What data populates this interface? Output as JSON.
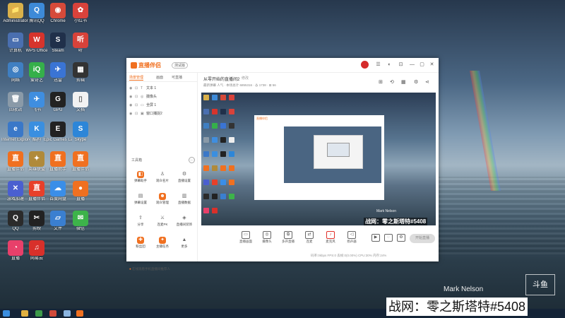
{
  "desktop": {
    "icons": [
      {
        "label": "Administrator",
        "color": "#d9b04a",
        "glyph": "📁"
      },
      {
        "label": "腾讯QQ",
        "color": "#3d8ad8",
        "glyph": "Q"
      },
      {
        "label": "Chrome",
        "color": "#d64a3a",
        "glyph": "◉"
      },
      {
        "label": "小红书",
        "color": "#d9423b",
        "glyph": "✿"
      },
      {
        "label": "计算机",
        "color": "#4a6fb0",
        "glyph": "▭"
      },
      {
        "label": "WPS Office",
        "color": "#d6342c",
        "glyph": "W"
      },
      {
        "label": "Steam",
        "color": "#20304a",
        "glyph": "S"
      },
      {
        "label": "听",
        "color": "#d8423a",
        "glyph": "听"
      },
      {
        "label": "网络",
        "color": "#3f7fc2",
        "glyph": "◎"
      },
      {
        "label": "爱奇艺",
        "color": "#35b04a",
        "glyph": "iQ"
      },
      {
        "label": "迅雷",
        "color": "#3a74d4",
        "glyph": "✈"
      },
      {
        "label": "剪辑",
        "color": "#333333",
        "glyph": "▦"
      },
      {
        "label": "回收站",
        "color": "#8a9aa8",
        "glyph": "🗑"
      },
      {
        "label": "飞书",
        "color": "#3f8ee0",
        "glyph": "✈"
      },
      {
        "label": "GPU",
        "color": "#222222",
        "glyph": "G"
      },
      {
        "label": "文档",
        "color": "#f2f2f2",
        "glyph": "▯"
      },
      {
        "label": "Internet Explorer",
        "color": "#3a78c8",
        "glyph": "e"
      },
      {
        "label": "酷狗",
        "color": "#3a8fe0",
        "glyph": "K"
      },
      {
        "label": "Epic Games Launcher",
        "color": "#222222",
        "glyph": "E"
      },
      {
        "label": "Skype",
        "color": "#2d86d8",
        "glyph": "S"
      },
      {
        "label": "直播伴侣",
        "color": "#f07020",
        "glyph": "直"
      },
      {
        "label": "英雄联盟",
        "color": "#b08a3a",
        "glyph": "✦"
      },
      {
        "label": "直播助手",
        "color": "#f07020",
        "glyph": "直"
      },
      {
        "label": "直播伴侣",
        "color": "#f07020",
        "glyph": "直"
      },
      {
        "label": "游戏加速",
        "color": "#4a5fd0",
        "glyph": "✕"
      },
      {
        "label": "直播伴侣",
        "color": "#e8402a",
        "glyph": "直"
      },
      {
        "label": "百度网盘",
        "color": "#3a8ee8",
        "glyph": "☁"
      },
      {
        "label": "直播",
        "color": "#f07020",
        "glyph": "●"
      },
      {
        "label": "QQ",
        "color": "#2b2b2b",
        "glyph": "Q"
      },
      {
        "label": "剪映",
        "color": "#222222",
        "glyph": "✂"
      },
      {
        "label": "文件",
        "color": "#3a7fd0",
        "glyph": "▱"
      },
      {
        "label": "微信",
        "color": "#3db34a",
        "glyph": "✉"
      },
      {
        "label": "直播",
        "color": "#e8406a",
        "glyph": "◔"
      },
      {
        "label": "网易云",
        "color": "#d8302a",
        "glyph": "♫"
      }
    ]
  },
  "app": {
    "name": "直播伴侣",
    "version_badge": "测试版",
    "tabs": [
      "场景管理",
      "画面",
      "可直播"
    ],
    "sources": [
      "文本 1",
      "摄像头",
      "全屏 1",
      "窗口捕捉2"
    ],
    "toolbox_title": "工具箱",
    "tools": [
      {
        "label": "弹幕助手",
        "color": "#f07020",
        "glyph": "◧"
      },
      {
        "label": "观众名片",
        "color": "#888888",
        "glyph": "♙"
      },
      {
        "label": "直播设置",
        "color": "#888888",
        "glyph": "⚙"
      },
      {
        "label": "弹幕设置",
        "color": "#888888",
        "glyph": "▤"
      },
      {
        "label": "观众管理",
        "color": "#f07020",
        "glyph": "☻"
      },
      {
        "label": "直播数据",
        "color": "#888888",
        "glyph": "▥"
      },
      {
        "label": "分享",
        "color": "#888888",
        "glyph": "⇪"
      },
      {
        "label": "连麦PK",
        "color": "#888888",
        "glyph": "⚔"
      },
      {
        "label": "直播间装饰",
        "color": "#888888",
        "glyph": "◈"
      },
      {
        "label": "粉丝团",
        "color": "#f07020",
        "glyph": "✚"
      },
      {
        "label": "主播任务",
        "color": "#f07020",
        "glyph": "✦"
      },
      {
        "label": "更多",
        "color": "#888888",
        "glyph": "▲"
      }
    ],
    "bottom_note": "在线观看手机直播间推荐人",
    "stream_title": "从零开始的直播间2",
    "stream_tag": "修改",
    "meta": "最新弹幕  人气  ·  本场总计  6855316  ·  ♨ 1738  ·  ⊞ 56",
    "preview_caption": "战网：零之斯塔特#5408",
    "preview_small": "Mark Nelson",
    "controls": [
      "直播画面",
      "摄像头",
      "多开直播",
      "连麦",
      "麦克风",
      "扬声器"
    ],
    "go_live": "开始直播",
    "status": "码率:0kbps  FPS:0  丢帧:0(0.00%)  CPU:30%  内存:24%"
  },
  "overlay": {
    "caption": "战网：零之斯塔特#5408",
    "watermark": "Mark Nelson",
    "corner_logo": "斗鱼"
  }
}
